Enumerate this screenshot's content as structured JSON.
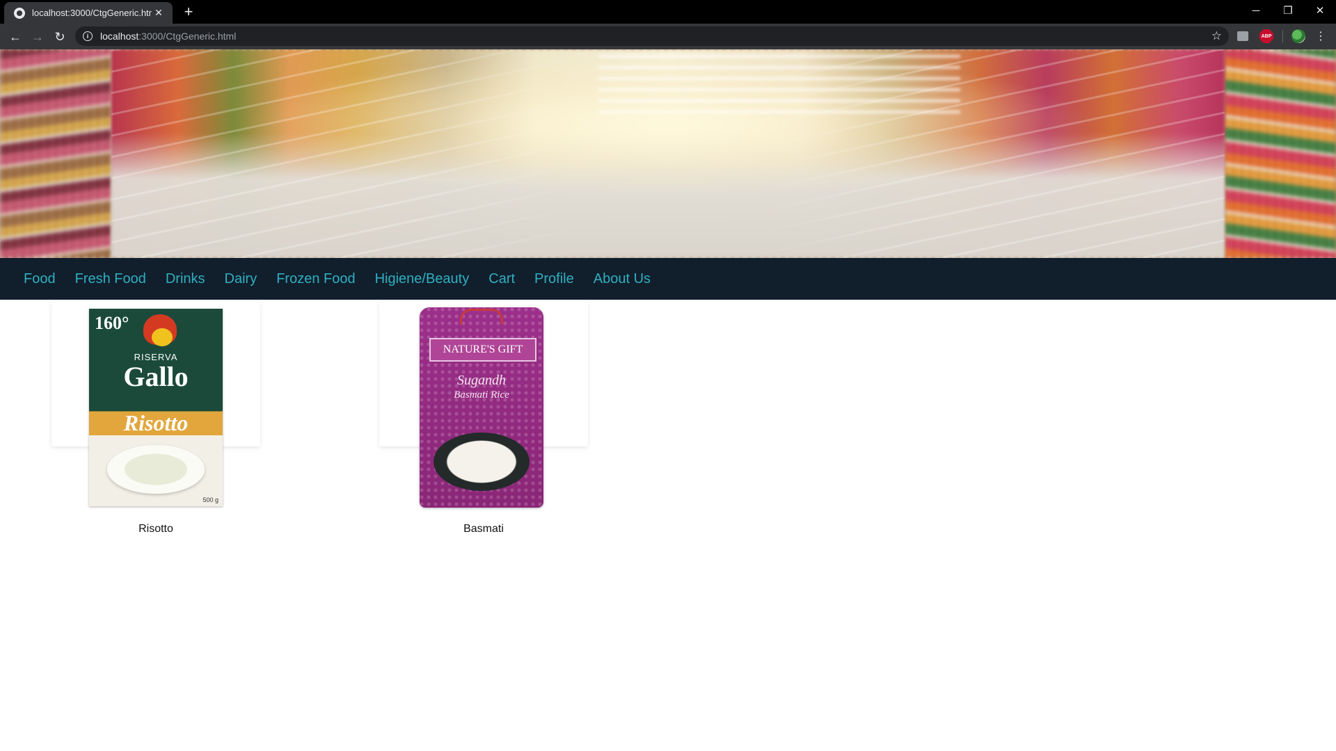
{
  "browser": {
    "tab_title": "localhost:3000/CtgGeneric.html",
    "new_tab_symbol": "+",
    "url_host": "localhost",
    "url_path": ":3000/CtgGeneric.html",
    "window_controls": {
      "minimize": "─",
      "restore": "❐",
      "close": "✕"
    },
    "extensions": {
      "abp_label": "ABP"
    }
  },
  "hero": {
    "image": "supermarket-aisle-banner"
  },
  "nav": {
    "links": [
      "Food",
      "Fresh Food",
      "Drinks",
      "Dairy",
      "Frozen Food",
      "Higiene/Beauty",
      "Cart",
      "Profile",
      "About Us"
    ],
    "color": "#2fb0c0",
    "background": "#111e2c"
  },
  "products": [
    {
      "name": "Risotto",
      "pack": {
        "badge": "160°",
        "brand_line": "RISERVA",
        "brand": "Gallo",
        "variety": "Risotto",
        "weight": "500 g"
      }
    },
    {
      "name": "Basmati",
      "pack": {
        "brand": "NATURE'S GIFT",
        "line1": "Sugandh",
        "line2": "Basmati Rice"
      }
    }
  ]
}
